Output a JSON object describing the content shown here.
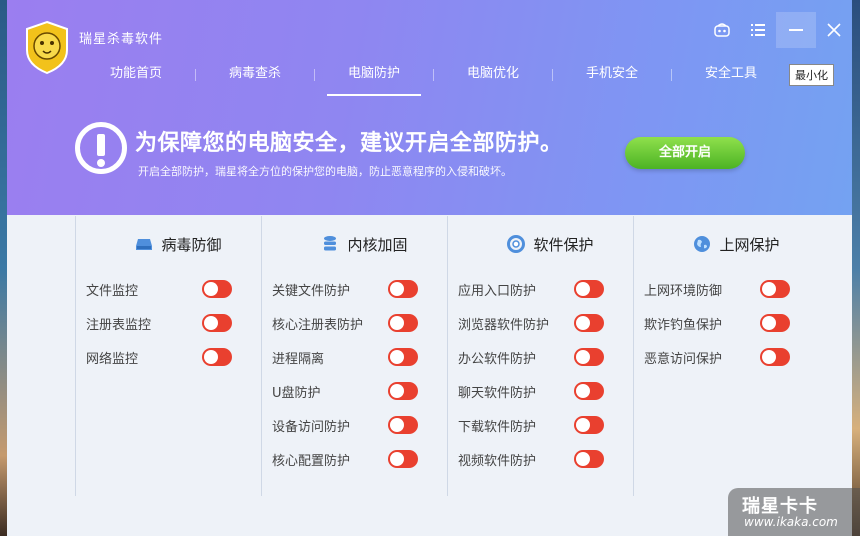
{
  "app": {
    "title": "瑞星杀毒软件"
  },
  "tooltip": "最小化",
  "nav": [
    {
      "label": "功能首页",
      "active": false
    },
    {
      "label": "病毒查杀",
      "active": false
    },
    {
      "label": "电脑防护",
      "active": true
    },
    {
      "label": "电脑优化",
      "active": false
    },
    {
      "label": "手机安全",
      "active": false
    },
    {
      "label": "安全工具",
      "active": false
    }
  ],
  "banner": {
    "title": "为保障您的电脑安全，建议开启全部防护。",
    "subtitle": "开启全部防护，瑞星将全方位的保护您的电脑，防止恶意程序的入侵和破坏。",
    "button": "全部开启"
  },
  "columns": [
    {
      "title": "病毒防御",
      "icon": "drive-icon",
      "items": [
        "文件监控",
        "注册表监控",
        "网络监控"
      ]
    },
    {
      "title": "内核加固",
      "icon": "database-icon",
      "items": [
        "关键文件防护",
        "核心注册表防护",
        "进程隔离",
        "U盘防护",
        "设备访问防护",
        "核心配置防护"
      ]
    },
    {
      "title": "软件保护",
      "icon": "lifebuoy-icon",
      "items": [
        "应用入口防护",
        "浏览器软件防护",
        "办公软件防护",
        "聊天软件防护",
        "下载软件防护",
        "视频软件防护"
      ]
    },
    {
      "title": "上网保护",
      "icon": "globe-icon",
      "items": [
        "上网环境防御",
        "欺诈钓鱼保护",
        "恶意访问保护"
      ]
    }
  ],
  "colors": {
    "toggle_off": "#e9402f",
    "header_start": "#9b7ef0",
    "header_end": "#74a2f2",
    "accent_green": "#4cb324"
  },
  "watermark": {
    "brand": "瑞星卡卡",
    "url": "www.ikaka.com"
  }
}
